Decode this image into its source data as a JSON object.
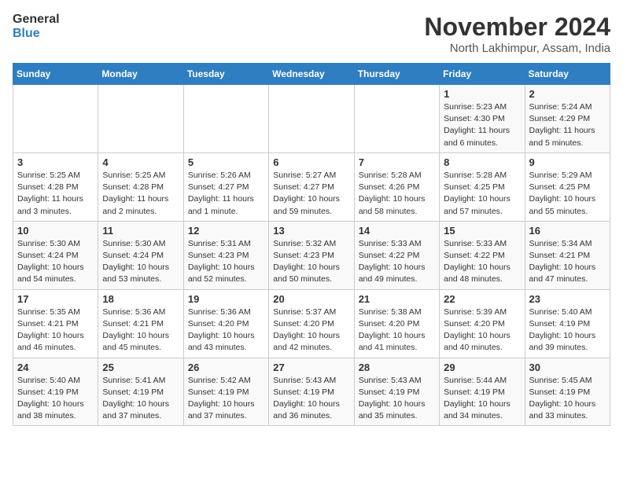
{
  "header": {
    "logo_line1": "General",
    "logo_line2": "Blue",
    "month_title": "November 2024",
    "location": "North Lakhimpur, Assam, India"
  },
  "weekdays": [
    "Sunday",
    "Monday",
    "Tuesday",
    "Wednesday",
    "Thursday",
    "Friday",
    "Saturday"
  ],
  "weeks": [
    [
      {
        "day": "",
        "info": ""
      },
      {
        "day": "",
        "info": ""
      },
      {
        "day": "",
        "info": ""
      },
      {
        "day": "",
        "info": ""
      },
      {
        "day": "",
        "info": ""
      },
      {
        "day": "1",
        "info": "Sunrise: 5:23 AM\nSunset: 4:30 PM\nDaylight: 11 hours\nand 6 minutes."
      },
      {
        "day": "2",
        "info": "Sunrise: 5:24 AM\nSunset: 4:29 PM\nDaylight: 11 hours\nand 5 minutes."
      }
    ],
    [
      {
        "day": "3",
        "info": "Sunrise: 5:25 AM\nSunset: 4:28 PM\nDaylight: 11 hours\nand 3 minutes."
      },
      {
        "day": "4",
        "info": "Sunrise: 5:25 AM\nSunset: 4:28 PM\nDaylight: 11 hours\nand 2 minutes."
      },
      {
        "day": "5",
        "info": "Sunrise: 5:26 AM\nSunset: 4:27 PM\nDaylight: 11 hours\nand 1 minute."
      },
      {
        "day": "6",
        "info": "Sunrise: 5:27 AM\nSunset: 4:27 PM\nDaylight: 10 hours\nand 59 minutes."
      },
      {
        "day": "7",
        "info": "Sunrise: 5:28 AM\nSunset: 4:26 PM\nDaylight: 10 hours\nand 58 minutes."
      },
      {
        "day": "8",
        "info": "Sunrise: 5:28 AM\nSunset: 4:25 PM\nDaylight: 10 hours\nand 57 minutes."
      },
      {
        "day": "9",
        "info": "Sunrise: 5:29 AM\nSunset: 4:25 PM\nDaylight: 10 hours\nand 55 minutes."
      }
    ],
    [
      {
        "day": "10",
        "info": "Sunrise: 5:30 AM\nSunset: 4:24 PM\nDaylight: 10 hours\nand 54 minutes."
      },
      {
        "day": "11",
        "info": "Sunrise: 5:30 AM\nSunset: 4:24 PM\nDaylight: 10 hours\nand 53 minutes."
      },
      {
        "day": "12",
        "info": "Sunrise: 5:31 AM\nSunset: 4:23 PM\nDaylight: 10 hours\nand 52 minutes."
      },
      {
        "day": "13",
        "info": "Sunrise: 5:32 AM\nSunset: 4:23 PM\nDaylight: 10 hours\nand 50 minutes."
      },
      {
        "day": "14",
        "info": "Sunrise: 5:33 AM\nSunset: 4:22 PM\nDaylight: 10 hours\nand 49 minutes."
      },
      {
        "day": "15",
        "info": "Sunrise: 5:33 AM\nSunset: 4:22 PM\nDaylight: 10 hours\nand 48 minutes."
      },
      {
        "day": "16",
        "info": "Sunrise: 5:34 AM\nSunset: 4:21 PM\nDaylight: 10 hours\nand 47 minutes."
      }
    ],
    [
      {
        "day": "17",
        "info": "Sunrise: 5:35 AM\nSunset: 4:21 PM\nDaylight: 10 hours\nand 46 minutes."
      },
      {
        "day": "18",
        "info": "Sunrise: 5:36 AM\nSunset: 4:21 PM\nDaylight: 10 hours\nand 45 minutes."
      },
      {
        "day": "19",
        "info": "Sunrise: 5:36 AM\nSunset: 4:20 PM\nDaylight: 10 hours\nand 43 minutes."
      },
      {
        "day": "20",
        "info": "Sunrise: 5:37 AM\nSunset: 4:20 PM\nDaylight: 10 hours\nand 42 minutes."
      },
      {
        "day": "21",
        "info": "Sunrise: 5:38 AM\nSunset: 4:20 PM\nDaylight: 10 hours\nand 41 minutes."
      },
      {
        "day": "22",
        "info": "Sunrise: 5:39 AM\nSunset: 4:20 PM\nDaylight: 10 hours\nand 40 minutes."
      },
      {
        "day": "23",
        "info": "Sunrise: 5:40 AM\nSunset: 4:19 PM\nDaylight: 10 hours\nand 39 minutes."
      }
    ],
    [
      {
        "day": "24",
        "info": "Sunrise: 5:40 AM\nSunset: 4:19 PM\nDaylight: 10 hours\nand 38 minutes."
      },
      {
        "day": "25",
        "info": "Sunrise: 5:41 AM\nSunset: 4:19 PM\nDaylight: 10 hours\nand 37 minutes."
      },
      {
        "day": "26",
        "info": "Sunrise: 5:42 AM\nSunset: 4:19 PM\nDaylight: 10 hours\nand 37 minutes."
      },
      {
        "day": "27",
        "info": "Sunrise: 5:43 AM\nSunset: 4:19 PM\nDaylight: 10 hours\nand 36 minutes."
      },
      {
        "day": "28",
        "info": "Sunrise: 5:43 AM\nSunset: 4:19 PM\nDaylight: 10 hours\nand 35 minutes."
      },
      {
        "day": "29",
        "info": "Sunrise: 5:44 AM\nSunset: 4:19 PM\nDaylight: 10 hours\nand 34 minutes."
      },
      {
        "day": "30",
        "info": "Sunrise: 5:45 AM\nSunset: 4:19 PM\nDaylight: 10 hours\nand 33 minutes."
      }
    ]
  ]
}
